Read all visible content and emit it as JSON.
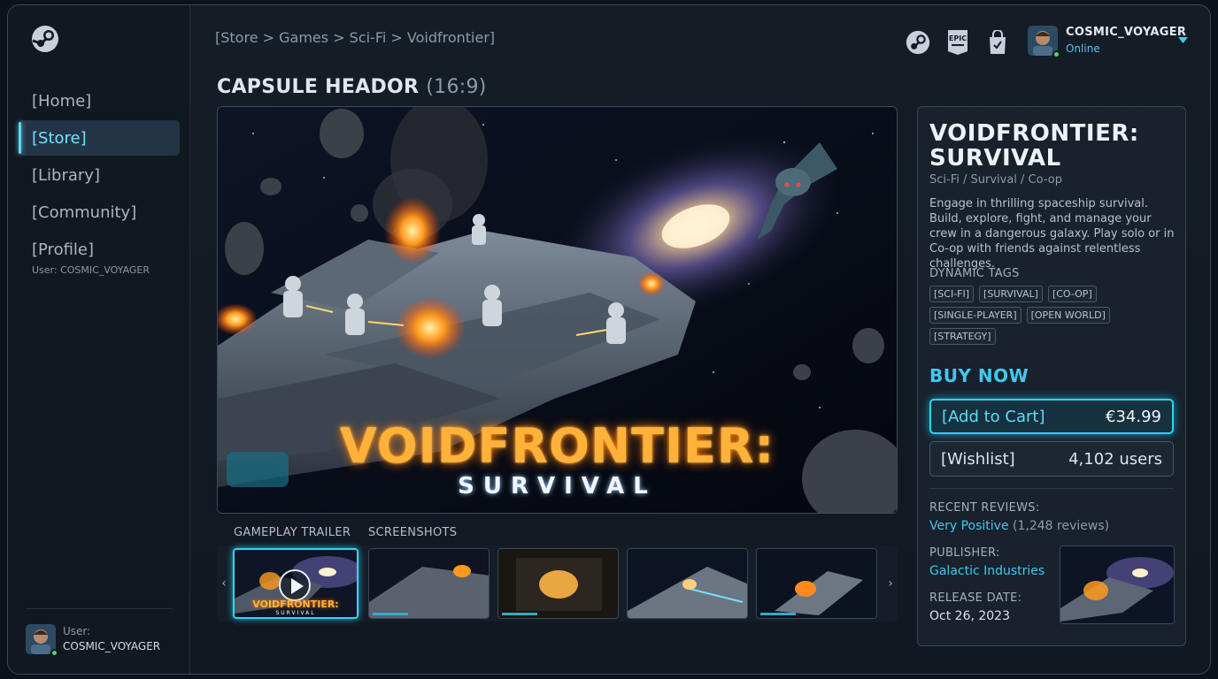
{
  "sidebar": {
    "logo": "steam-logo-icon",
    "items": [
      {
        "label": "[Home]"
      },
      {
        "label": "[Store]",
        "active": true
      },
      {
        "label": "[Library]"
      },
      {
        "label": "[Community]"
      },
      {
        "label": "[Profile]"
      }
    ],
    "profile_sub": "User: COSMIC_VOYAGER",
    "footer_user_label": "User:",
    "footer_user_name": "COSMIC_VOYAGER"
  },
  "header": {
    "breadcrumb": "[Store  >  Games  >  Sci-Fi  >  Voidfrontier]",
    "icons": [
      "steam-icon",
      "epic-games-icon",
      "shopping-bag-icon"
    ],
    "epic_text": "EPIC",
    "user_name": "COSMIC_VOYAGER",
    "user_status": "Online"
  },
  "main": {
    "title": "CAPSULE HEADOR",
    "title_suffix": "(16:9)",
    "capsule_title": "VOIDFRONTIER:",
    "capsule_subtitle": "SURVIVAL",
    "media_labels": {
      "trailer": "GAMEPLAY TRAILER",
      "screenshots": "SCREENSHOTS"
    },
    "thumb_title": "VOIDFRONTIER:",
    "thumb_subtitle": "SURVIVAL"
  },
  "panel": {
    "game_title": "VOIDFRONTIER: SURVIVAL",
    "genre": "Sci-Fi / Survival / Co-op",
    "description": "Engage in thrilling spaceship survival. Build, explore, fight, and manage your crew in a dangerous galaxy. Play solo or in Co-op with friends against relentless challenges.",
    "tags_heading": "DYNAMIC TAGS",
    "tags": [
      "[SCI-FI]",
      "[SURVIVAL]",
      "[CO-OP]",
      "[SINGLE-PLAYER]",
      "[OPEN WORLD]",
      "[STRATEGY]"
    ],
    "buy_heading": "BUY NOW",
    "add_to_cart_label": "[Add to Cart]",
    "price": "€34.99",
    "wishlist_label": "[Wishlist]",
    "wishlist_count": "4,102 users",
    "reviews_label": "RECENT REVIEWS:",
    "reviews_value": "Very Positive",
    "reviews_count": "(1,248 reviews)",
    "publisher_label": "PUBLISHER:",
    "publisher_value": "Galactic Industries",
    "release_label": "RELEASE DATE:",
    "release_value": "Oct 26, 2023"
  },
  "colors": {
    "accent": "#43c8ee",
    "title_glow": "#ffb23a",
    "background": "#111821",
    "online": "#4cd964"
  }
}
